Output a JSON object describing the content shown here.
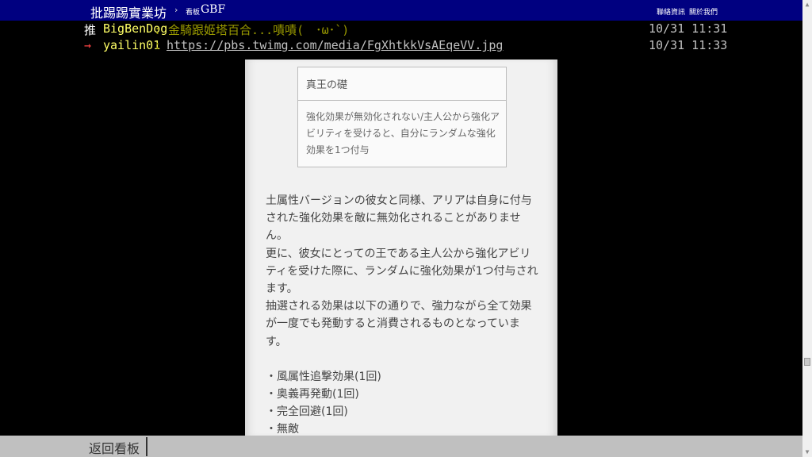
{
  "header": {
    "site_name": "批踢踢實業坊",
    "separator": "›",
    "board_label": "看板",
    "board_name": "GBF",
    "contact_link": "聯絡資訊",
    "about_link": "關於我們"
  },
  "pushes": [
    {
      "tag": "推",
      "user": "BigBenDog",
      "content": ": 金騎跟姬塔百合...嘖嘖(　･ω･`)",
      "time": "10/31 11:31"
    },
    {
      "tag": "→",
      "user": "yailin01",
      "sep": ":",
      "content": "https://pbs.twimg.com/media/FgXhtkkVsAEqeVV.jpg",
      "time": "10/31 11:33"
    }
  ],
  "embed": {
    "skill_title": "真王の礎",
    "skill_desc": "強化効果が無効化されない/主人公から強化アビリティを受けると、自分にランダムな強化効果を1つ付与",
    "paragraphs": [
      "土属性バージョンの彼女と同様、アリアは自身に付与された強化効果を敵に無効化されることがありません。",
      "更に、彼女にとっての王である主人公から強化アビリティを受けた際に、ランダムに強化効果が1つ付与されます。",
      "抽選される効果は以下の通りで、強力ながら全て効果が一度でも発動すると消費されるものとなっています。"
    ],
    "effects": [
      "・風属性追撃効果(1回)",
      "・奥義再発動(1回)",
      "・完全回避(1回)",
      "・無敵"
    ]
  },
  "footer": {
    "back_label": "返回看板"
  },
  "scrollbar": {
    "up_icon": "▲",
    "down_icon": "▼"
  }
}
